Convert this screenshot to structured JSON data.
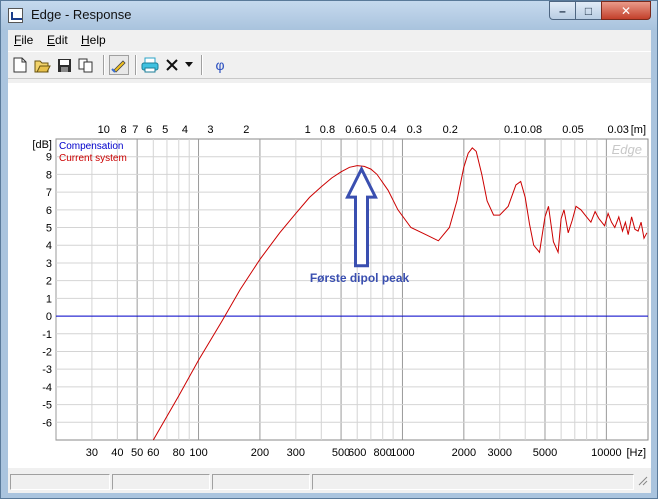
{
  "window": {
    "title": "Edge - Response",
    "minimize_glyph": "–",
    "maximize_glyph": "□",
    "close_glyph": "✕"
  },
  "menu": {
    "file": {
      "underlined": "F",
      "rest": "ile"
    },
    "edit": {
      "underlined": "E",
      "rest": "dit"
    },
    "help": {
      "underlined": "H",
      "rest": "elp"
    }
  },
  "toolbar": {
    "icons": [
      "new-file-icon",
      "open-folder-icon",
      "save-icon",
      "copy-icon",
      "pencil-edit-icon",
      "printer-icon",
      "delete-x-icon",
      "dropdown-arrow-icon",
      "phi-icon"
    ],
    "phi_label": "φ"
  },
  "chart_data": {
    "type": "line",
    "watermark": "Edge",
    "x_scale": "log",
    "xlim": [
      20,
      16000
    ],
    "ylim": [
      -7,
      10
    ],
    "grid": true,
    "legend_position": "top-left",
    "y_unit_label": "[dB]",
    "bottom_unit_label": "[Hz]",
    "top_unit_label": "[m]",
    "y_ticks": [
      9,
      8,
      7,
      6,
      5,
      4,
      3,
      2,
      1,
      0,
      -1,
      -2,
      -3,
      -4,
      -5,
      -6
    ],
    "x_ticks": [
      30,
      40,
      50,
      60,
      80,
      100,
      200,
      300,
      500,
      600,
      800,
      1000,
      2000,
      3000,
      5000,
      10000
    ],
    "x_tick_labels": [
      "30",
      "40",
      "50",
      "60",
      "80",
      "100",
      "200",
      "300",
      "500",
      "600",
      "800",
      "1000",
      "2000",
      "3000",
      "5000",
      "10000"
    ],
    "top_ticks": [
      10,
      8,
      7,
      6,
      5,
      4,
      3,
      2,
      1,
      0.8,
      0.6,
      0.5,
      0.4,
      0.3,
      0.2,
      0.1,
      0.08,
      0.05,
      0.03
    ],
    "top_tick_labels": [
      "10",
      "8",
      "7",
      "6",
      "5",
      "4",
      "3",
      "2",
      "1",
      "0.8",
      "0.6",
      "0.5",
      "0.4",
      "0.3",
      "0.2",
      "0.1",
      "0.08",
      "0.05",
      "0.03"
    ],
    "series": [
      {
        "name": "Compensation",
        "color": "#0000cc",
        "x": [
          20,
          16000
        ],
        "y": [
          0,
          0
        ]
      },
      {
        "name": "Current system",
        "color": "#cc0000",
        "x": [
          60,
          80,
          100,
          130,
          160,
          200,
          250,
          300,
          350,
          400,
          450,
          500,
          550,
          600,
          650,
          700,
          750,
          850,
          950,
          1100,
          1300,
          1500,
          1700,
          1850,
          2000,
          2100,
          2200,
          2300,
          2450,
          2600,
          2800,
          3000,
          3300,
          3600,
          3800,
          4000,
          4200,
          4400,
          4700,
          5000,
          5200,
          5500,
          5800,
          6000,
          6200,
          6500,
          6800,
          7100,
          7500,
          8000,
          8400,
          8800,
          9200,
          9800,
          10200,
          10600,
          11000,
          11500,
          12000,
          12400,
          12800,
          13300,
          13800,
          14300,
          14800,
          15300,
          15800
        ],
        "y": [
          -7,
          -4.5,
          -2.5,
          -0.3,
          1.5,
          3.2,
          4.7,
          5.8,
          6.7,
          7.3,
          7.8,
          8.15,
          8.4,
          8.5,
          8.45,
          8.3,
          8.0,
          7.1,
          6.0,
          5.0,
          4.6,
          4.25,
          5.0,
          6.5,
          8.4,
          9.2,
          9.5,
          9.3,
          8.0,
          6.5,
          5.7,
          5.7,
          6.2,
          7.4,
          7.6,
          6.7,
          5.2,
          4.0,
          3.6,
          5.6,
          6.2,
          4.2,
          3.6,
          5.5,
          6.0,
          4.7,
          5.4,
          6.2,
          6.0,
          5.6,
          5.3,
          5.9,
          5.5,
          5.1,
          5.8,
          5.3,
          5.0,
          5.6,
          4.8,
          5.3,
          4.6,
          5.6,
          4.9,
          4.8,
          5.3,
          4.4,
          4.7
        ]
      }
    ],
    "annotation": {
      "text": "Første dipol peak",
      "x": 630,
      "y": 2.5,
      "arrow_tip_y": 8.3,
      "color": "#3a4fb0"
    }
  }
}
